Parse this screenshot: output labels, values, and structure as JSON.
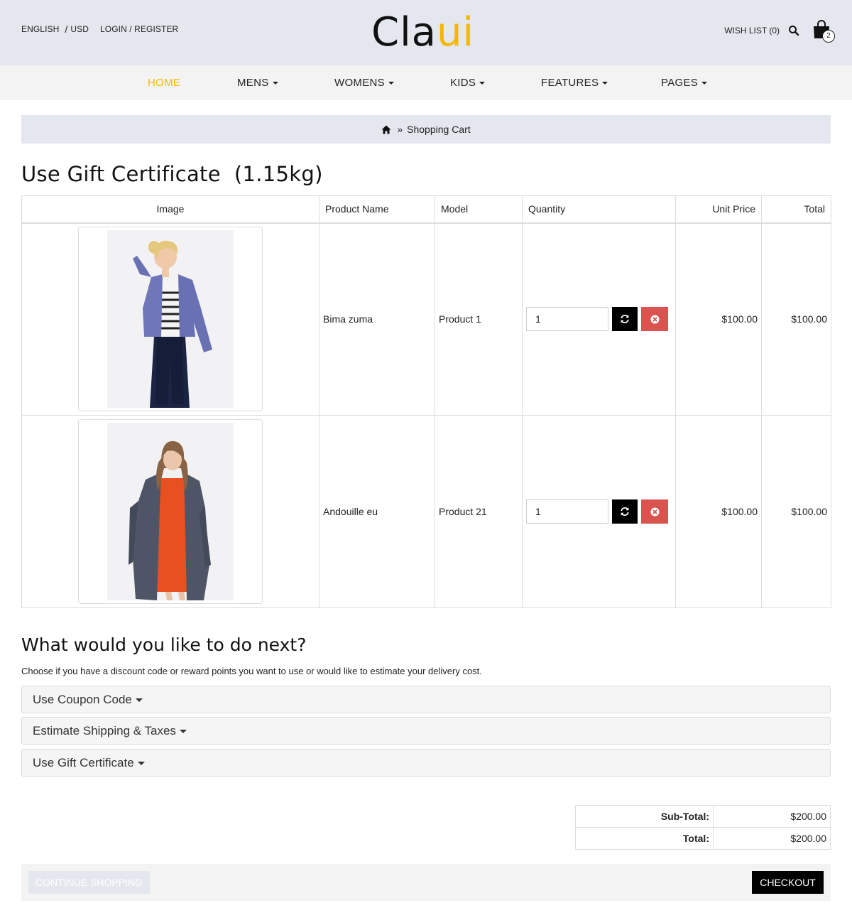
{
  "header": {
    "language": "ENGLISH",
    "currency_sep": "/",
    "currency": "USD",
    "login_register": "LOGIN / REGISTER",
    "logo_main": "Cla",
    "logo_accent": "ui",
    "wishlist": "WISH LIST (0)",
    "cart_count": "2",
    "accent_color": "#f5b800",
    "icons": [
      "search-icon",
      "shopping-bag-icon"
    ]
  },
  "nav": {
    "items": [
      {
        "label": "HOME",
        "active": true
      },
      {
        "label": "MENS",
        "dropdown": true
      },
      {
        "label": "WOMENS",
        "dropdown": true
      },
      {
        "label": "KIDS",
        "dropdown": true
      },
      {
        "label": "FEATURES",
        "dropdown": true
      },
      {
        "label": "PAGES",
        "dropdown": true
      }
    ]
  },
  "breadcrumb": {
    "separator": "»",
    "current": "Shopping Cart"
  },
  "page": {
    "title": "Use Gift Certificate  (1.15kg)"
  },
  "cart": {
    "columns": [
      "Image",
      "Product Name",
      "Model",
      "Quantity",
      "Unit Price",
      "Total"
    ],
    "rows": [
      {
        "name": "Bima zuma",
        "model": "Product 1",
        "quantity": "1",
        "unit_price": "$100.00",
        "total": "$100.00"
      },
      {
        "name": "Andouille eu",
        "model": "Product 21",
        "quantity": "1",
        "unit_price": "$100.00",
        "total": "$100.00"
      }
    ]
  },
  "next": {
    "title": "What would you like to do next?",
    "text": "Choose if you have a discount code or reward points you want to use or would like to estimate your delivery cost.",
    "panels": [
      "Use Coupon Code",
      "Estimate Shipping & Taxes",
      "Use Gift Certificate"
    ]
  },
  "totals": [
    {
      "label": "Sub-Total:",
      "value": "$200.00"
    },
    {
      "label": "Total:",
      "value": "$200.00"
    }
  ],
  "buttons": {
    "continue": "CONTINUE SHOPPING",
    "checkout": "CHECKOUT"
  }
}
